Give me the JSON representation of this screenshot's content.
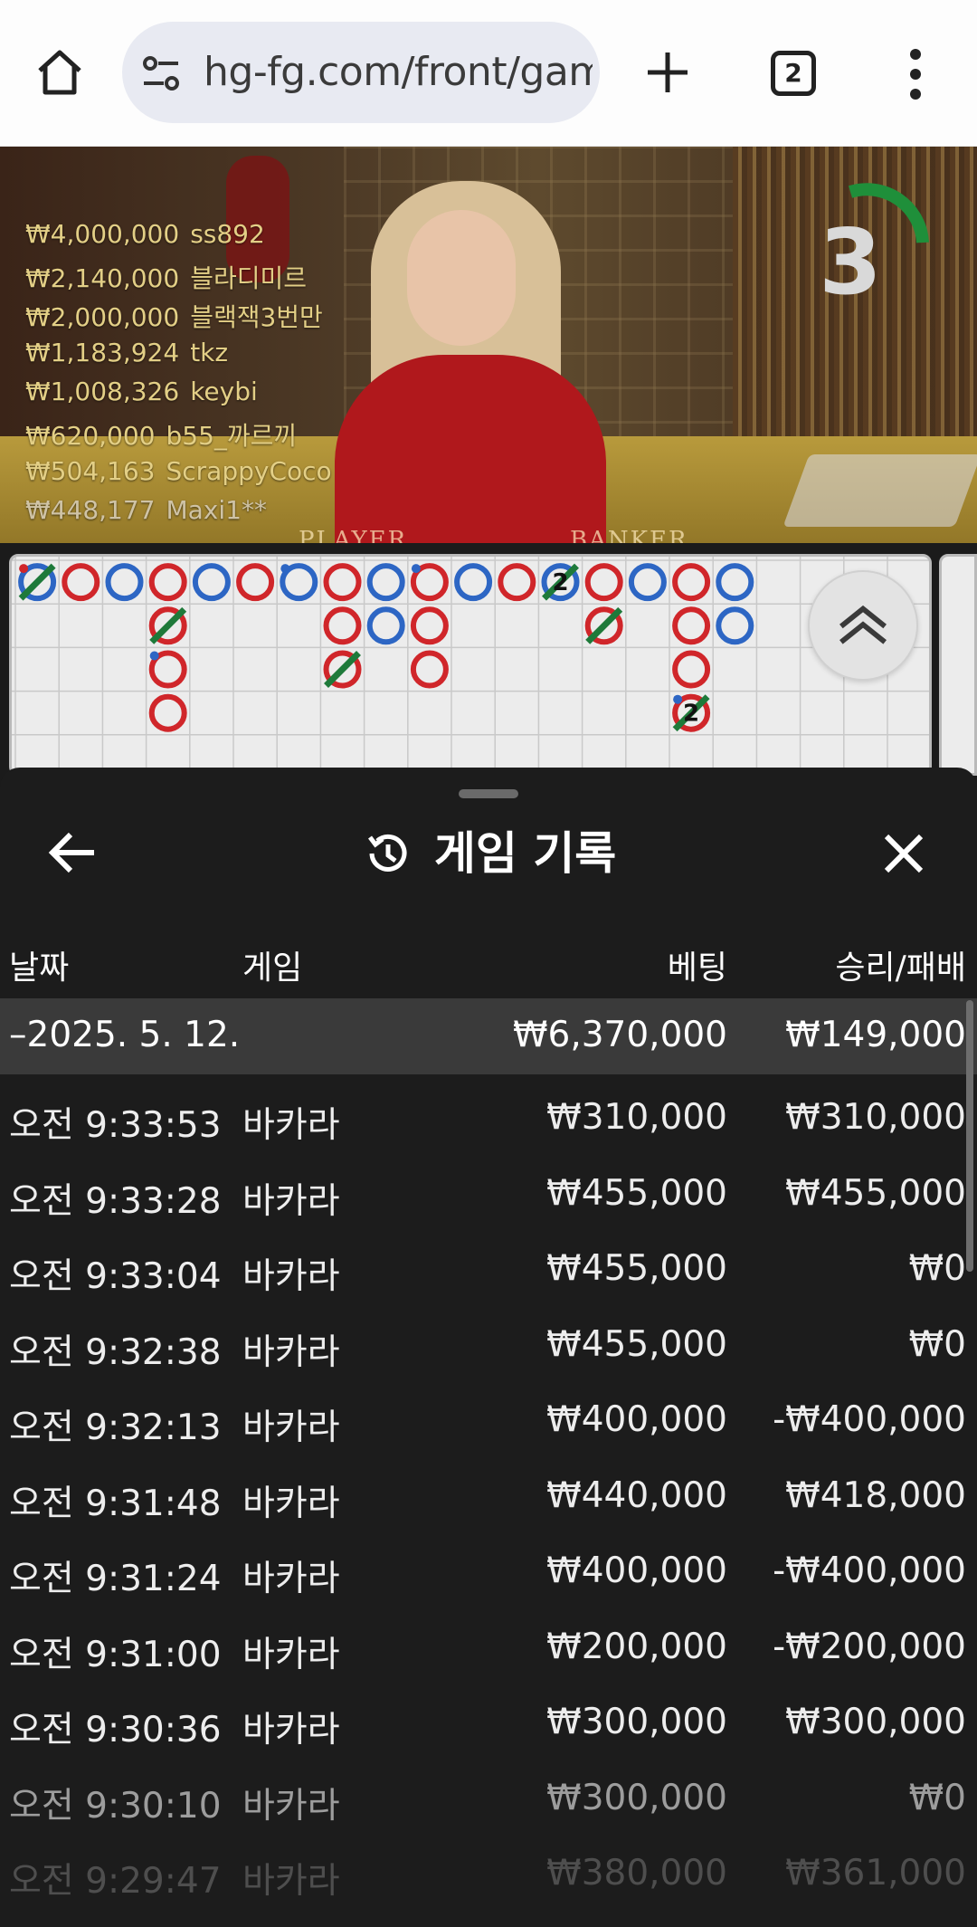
{
  "browser": {
    "url": "hg-fg.com/front/gam",
    "tab_count": "2"
  },
  "video": {
    "timer_value": "3",
    "table_labels": [
      "PLAYER",
      "BANKER"
    ],
    "winners": [
      {
        "amount": "₩4,000,000",
        "name": "ss892"
      },
      {
        "amount": "₩2,140,000",
        "name": "블라디미르"
      },
      {
        "amount": "₩2,000,000",
        "name": "블랙잭3번만"
      },
      {
        "amount": "₩1,183,924",
        "name": "tkz"
      },
      {
        "amount": "₩1,008,326",
        "name": "keybi"
      },
      {
        "amount": "₩620,000",
        "name": "b55_까르끼"
      },
      {
        "amount": "₩504,163",
        "name": "ScrappyCoco"
      },
      {
        "amount": "₩448,177",
        "name": "Maxi1**"
      }
    ]
  },
  "bead_road": {
    "colors": {
      "banker": "#d0262a",
      "player": "#2d66c4",
      "tie": "#1e7a3a"
    },
    "columns": [
      [
        {
          "c": "player",
          "tie": true,
          "dot": "banker"
        }
      ],
      [
        {
          "c": "banker"
        }
      ],
      [
        {
          "c": "player"
        }
      ],
      [
        {
          "c": "banker"
        },
        {
          "c": "banker",
          "tie": true
        },
        {
          "c": "banker",
          "dot": "player"
        },
        {
          "c": "banker"
        }
      ],
      [
        {
          "c": "player"
        }
      ],
      [
        {
          "c": "banker"
        }
      ],
      [
        {
          "c": "player",
          "dot": "player"
        }
      ],
      [
        {
          "c": "banker"
        },
        {
          "c": "banker"
        },
        {
          "c": "banker",
          "tie": true
        }
      ],
      [
        {
          "c": "player"
        },
        {
          "c": "player"
        }
      ],
      [
        {
          "c": "banker",
          "dot": "player"
        },
        {
          "c": "banker"
        },
        {
          "c": "banker"
        }
      ],
      [
        {
          "c": "player"
        }
      ],
      [
        {
          "c": "banker"
        }
      ],
      [
        {
          "c": "player",
          "tie": true,
          "num": "2"
        }
      ],
      [
        {
          "c": "banker"
        },
        {
          "c": "banker",
          "tie": true
        }
      ],
      [
        {
          "c": "player"
        }
      ],
      [
        {
          "c": "banker"
        },
        {
          "c": "banker"
        },
        {
          "c": "banker"
        },
        {
          "c": "banker",
          "tie": true,
          "num": "2",
          "dot": "player"
        }
      ],
      [
        {
          "c": "player"
        },
        {
          "c": "player"
        }
      ]
    ]
  },
  "history": {
    "title": "게임 기록",
    "columns": {
      "date": "날짜",
      "game": "게임",
      "bet": "베팅",
      "result": "승리/패배"
    },
    "summary": {
      "date": "–2025. 5. 12.",
      "bet": "₩6,370,000",
      "result": "₩149,000"
    },
    "rows": [
      {
        "time": "오전 9:33:53",
        "game": "바카라",
        "bet": "₩310,000",
        "result": "₩310,000"
      },
      {
        "time": "오전 9:33:28",
        "game": "바카라",
        "bet": "₩455,000",
        "result": "₩455,000"
      },
      {
        "time": "오전 9:33:04",
        "game": "바카라",
        "bet": "₩455,000",
        "result": "₩0"
      },
      {
        "time": "오전 9:32:38",
        "game": "바카라",
        "bet": "₩455,000",
        "result": "₩0"
      },
      {
        "time": "오전 9:32:13",
        "game": "바카라",
        "bet": "₩400,000",
        "result": "-₩400,000"
      },
      {
        "time": "오전 9:31:48",
        "game": "바카라",
        "bet": "₩440,000",
        "result": "₩418,000"
      },
      {
        "time": "오전 9:31:24",
        "game": "바카라",
        "bet": "₩400,000",
        "result": "-₩400,000"
      },
      {
        "time": "오전 9:31:00",
        "game": "바카라",
        "bet": "₩200,000",
        "result": "-₩200,000"
      },
      {
        "time": "오전 9:30:36",
        "game": "바카라",
        "bet": "₩300,000",
        "result": "₩300,000"
      },
      {
        "time": "오전 9:30:10",
        "game": "바카라",
        "bet": "₩300,000",
        "result": "₩0"
      },
      {
        "time": "오전 9:29:47",
        "game": "바카라",
        "bet": "₩380,000",
        "result": "₩361,000"
      }
    ]
  }
}
